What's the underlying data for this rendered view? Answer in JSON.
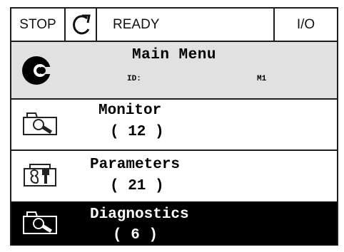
{
  "status_bar": {
    "stop_label": "STOP",
    "ready_label": "READY",
    "io_label": "I/O",
    "rotation_icon": "rotation-icon"
  },
  "header": {
    "title": "Main Menu",
    "id_label": "ID:",
    "id_value": "M1",
    "logo_icon": "main-menu-logo-icon"
  },
  "menu": {
    "items": [
      {
        "label": "Monitor",
        "count": "( 12 )",
        "icon": "monitor-icon",
        "selected": false
      },
      {
        "label": "Parameters",
        "count": "( 21 )",
        "icon": "parameters-icon",
        "selected": false
      },
      {
        "label": "Diagnostics",
        "count": "( 6 )",
        "icon": "diagnostics-icon",
        "selected": true
      }
    ]
  },
  "colors": {
    "border": "#1c1c1c",
    "header_bg": "#e1e1e1",
    "selected_bg": "#000000",
    "selected_fg": "#ffffff"
  }
}
